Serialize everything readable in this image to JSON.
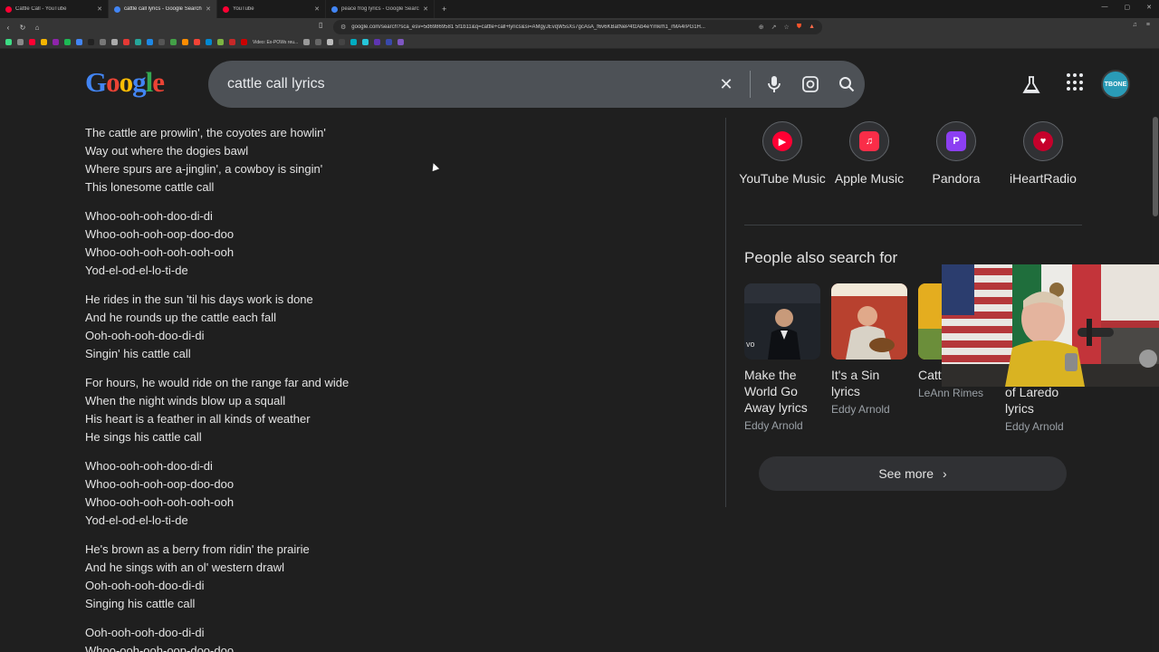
{
  "browser": {
    "tabs": [
      {
        "title": "Cattle Call - YouTube",
        "active": false,
        "favicon_color": "#ff0033"
      },
      {
        "title": "cattle call lyrics - Google Search",
        "active": true,
        "favicon_color": "#4285f4"
      },
      {
        "title": "YouTube",
        "active": false,
        "favicon_color": "#ff0033"
      },
      {
        "title": "peace frog lyrics - Google Search",
        "active": false,
        "favicon_color": "#4285f4"
      }
    ],
    "new_tab": "+",
    "url": "google.com/search?sca_esv=5d69869581 5f1b11&q=cattle+call+lyrics&si=AMgyJEvqW5sXs7gcAsA_f6v6KBatNeP4fzAb4eYmkrh1_rMA4rPG1H...",
    "bookmark_label": "Video: Ex-POWs reu..."
  },
  "search": {
    "logo": [
      "G",
      "o",
      "o",
      "g",
      "l",
      "e"
    ],
    "query": "cattle call lyrics"
  },
  "user": {
    "avatar_text": "TBONE"
  },
  "lyrics": [
    [
      "The cattle are prowlin', the coyotes are howlin'",
      "Way out where the dogies bawl",
      "Where spurs are a-jinglin', a cowboy is singin'",
      "This lonesome cattle call"
    ],
    [
      "Whoo-ooh-ooh-doo-di-di",
      "Whoo-ooh-ooh-oop-doo-doo",
      "Whoo-ooh-ooh-ooh-ooh-ooh",
      "Yod-el-od-el-lo-ti-de"
    ],
    [
      "He rides in the sun 'til his days work is done",
      "And he rounds up the cattle each fall",
      "Ooh-ooh-ooh-doo-di-di",
      "Singin' his cattle call"
    ],
    [
      "For hours, he would ride on the range far and wide",
      "When the night winds blow up a squall",
      "His heart is a feather in all kinds of weather",
      "He sings his cattle call"
    ],
    [
      "Whoo-ooh-ooh-doo-di-di",
      "Whoo-ooh-ooh-oop-doo-doo",
      "Whoo-ooh-ooh-ooh-ooh-ooh",
      "Yod-el-od-el-lo-ti-de"
    ],
    [
      "He's brown as a berry from ridin' the prairie",
      "And he sings with an ol' western drawl",
      "Ooh-ooh-ooh-doo-di-di",
      "Singing his cattle call"
    ],
    [
      "Ooh-ooh-ooh-doo-di-di",
      "Whoo-ooh-ooh-oop-doo-doo"
    ]
  ],
  "streaming": [
    {
      "label": "YouTube Music",
      "color": "#ff0033",
      "icon": "youtube-music-icon"
    },
    {
      "label": "Apple Music",
      "color": "#fa2d48",
      "icon": "apple-music-icon"
    },
    {
      "label": "Pandora",
      "color": "#8c3ff2",
      "icon": "pandora-icon"
    },
    {
      "label": "iHeartRadio",
      "color": "#c6002b",
      "icon": "iheartradio-icon"
    }
  ],
  "people_also_search": {
    "title": "People also search for",
    "items": [
      {
        "name": "Make the World Go Away lyrics",
        "artist": "Eddy Arnold"
      },
      {
        "name": "It's a Sin lyrics",
        "artist": "Eddy Arnold"
      },
      {
        "name": "Catt lyrics",
        "artist": "LeAnn Rimes"
      },
      {
        "name": "of Laredo lyrics",
        "artist": "Eddy Arnold"
      }
    ],
    "see_more": "See more"
  }
}
